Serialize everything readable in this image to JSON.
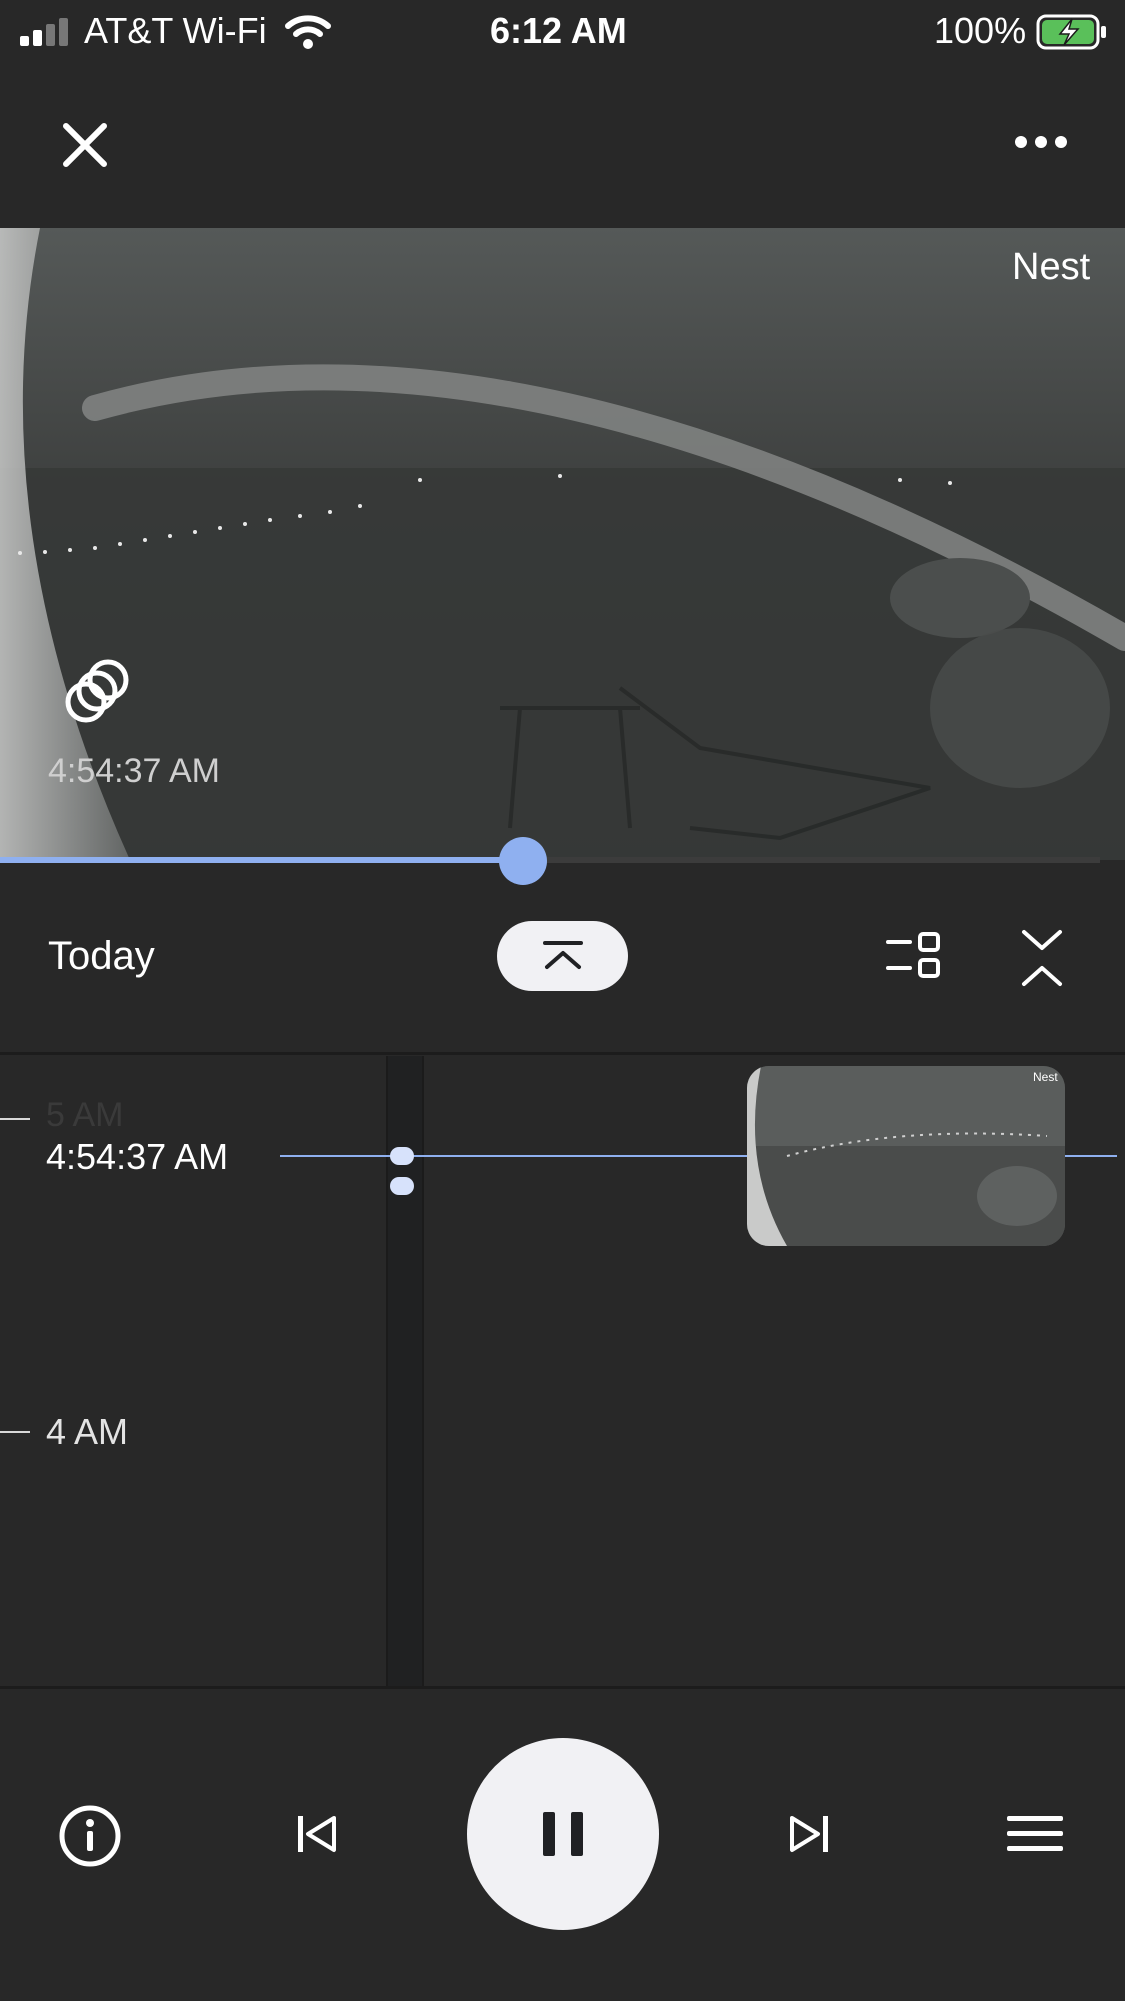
{
  "status_bar": {
    "carrier": "AT&T Wi-Fi",
    "time": "6:12 AM",
    "battery": "100%",
    "battery_color": "#5ac05a"
  },
  "header": {
    "close_icon": "close-icon",
    "more_icon": "more-horizontal-icon"
  },
  "video": {
    "watermark": "Nest",
    "timestamp": "4:54:37 AM",
    "event_icon": "motion-circles-icon",
    "progress": 0.465
  },
  "controls": {
    "date_label": "Today",
    "jump_icon": "jump-to-top-icon",
    "filter_icon": "filter-icon",
    "collapse_icon": "collapse-expand-icon"
  },
  "timeline": {
    "partial_label": "5 AM",
    "current_time": "4:54:37 AM",
    "hour_label": "4 AM",
    "thumbnail_watermark": "Nest",
    "accent": "#8fb0f0"
  },
  "bottom_bar": {
    "info_icon": "info-icon",
    "prev_icon": "skip-previous-icon",
    "pause_icon": "pause-icon",
    "next_icon": "skip-next-icon",
    "menu_icon": "menu-icon"
  }
}
